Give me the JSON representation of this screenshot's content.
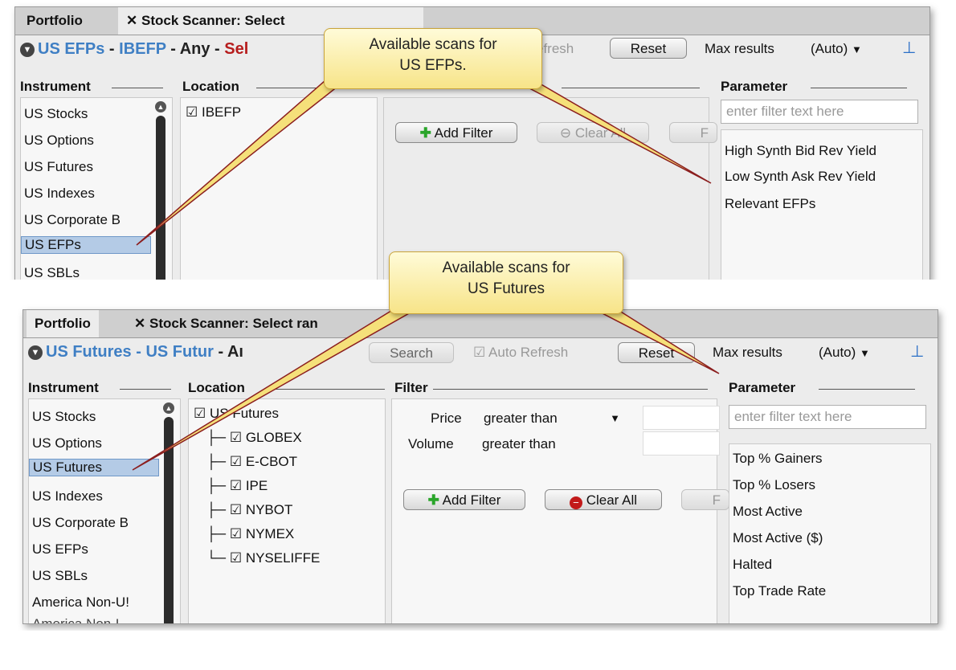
{
  "colors": {
    "accent_blue": "#3f7fc4",
    "selected_row": "#b4cbe6",
    "callout_fill": "#f7e488",
    "pointer_line": "#8b1e1e"
  },
  "top": {
    "tabs": [
      "Portfolio",
      "Stock Scanner: Select"
    ],
    "close_icon": "✕",
    "title": {
      "part1": "US EFPs",
      "sep1": " - ",
      "part2": "IBEFP",
      "part3": " - Any - ",
      "part4": "Sel"
    },
    "refresh_fragment": "efresh",
    "reset_label": "Reset",
    "max_results_label": "Max results",
    "max_results_value": "(Auto)",
    "instrument_header": "Instrument",
    "location_header": "Location",
    "parameter_header": "Parameter",
    "instruments": [
      "US Stocks",
      "US Options",
      "US Futures",
      "US Indexes",
      "US Corporate B",
      "US EFPs",
      "US SBLs"
    ],
    "selected_instrument": "US EFPs",
    "locations": [
      "IBEFP"
    ],
    "add_filter_label": "Add Filter",
    "clear_all_label": "Clear All",
    "third_btn_fragment": "F",
    "filter_placeholder": "enter filter text here",
    "parameters": [
      "High Synth Bid Rev Yield",
      "Low Synth Ask Rev Yield",
      "Relevant EFPs"
    ],
    "callout": [
      "Available scans for",
      "US EFPs."
    ]
  },
  "bottom": {
    "tabs": [
      "Portfolio",
      "Stock Scanner: Select"
    ],
    "tab2_tail": "ran",
    "close_icon": "✕",
    "title": {
      "part1": "US Futures",
      "sep1": " - ",
      "part2": "US Futur",
      "part3": " - Aı"
    },
    "search_label": "Search",
    "auto_refresh_label": "Auto Refresh",
    "reset_label": "Reset",
    "max_results_label": "Max results",
    "max_results_value": "(Auto)",
    "instrument_header": "Instrument",
    "location_header": "Location",
    "filter_header": "Filter",
    "parameter_header": "Parameter",
    "instruments": [
      "US Stocks",
      "US Options",
      "US Futures",
      "US Indexes",
      "US Corporate B",
      "US EFPs",
      "US SBLs",
      "America Non-U!",
      "America Non-L"
    ],
    "selected_instrument": "US Futures",
    "location_root": "US Futures",
    "locations": [
      "GLOBEX",
      "E-CBOT",
      "IPE",
      "NYBOT",
      "NYMEX",
      "NYSELIFFE"
    ],
    "filters": [
      {
        "label": "Price",
        "operator": "greater than"
      },
      {
        "label": "Volume",
        "operator": "greater than"
      }
    ],
    "add_filter_label": "Add Filter",
    "clear_all_label": "Clear All",
    "third_btn_fragment": "F",
    "filter_placeholder": "enter filter text here",
    "parameters": [
      "Top % Gainers",
      "Top % Losers",
      "Most Active",
      "Most Active ($)",
      "Halted",
      "Top Trade Rate"
    ],
    "callout": [
      "Available scans for",
      "US Futures"
    ]
  }
}
